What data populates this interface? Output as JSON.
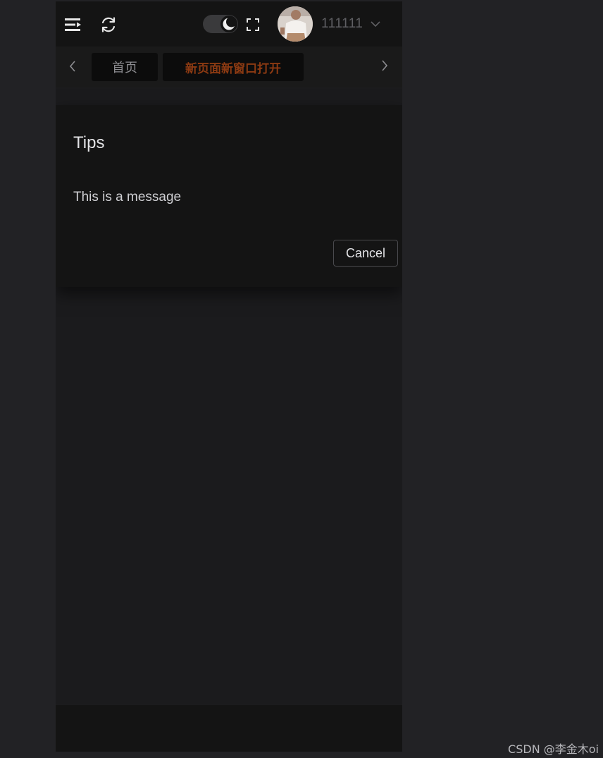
{
  "header": {
    "menu_icon": "menu-fold-icon",
    "refresh_icon": "refresh-icon",
    "theme_toggle_icon": "moon-icon",
    "fullscreen_icon": "fullscreen-icon",
    "avatar_icon": "user-avatar",
    "user_name": "111111",
    "caret_icon": "chevron-down-icon"
  },
  "tags": {
    "prev_icon": "chevron-left-icon",
    "next_icon": "chevron-right-icon",
    "items": [
      {
        "label": "首页",
        "active": false
      },
      {
        "label": "新页面新窗口打开",
        "active": true
      }
    ],
    "active_color": "#8c3a12"
  },
  "dialog": {
    "title": "Tips",
    "message": "This is a message",
    "cancel_label": "Cancel"
  },
  "watermark": "CSDN @李金木oi"
}
